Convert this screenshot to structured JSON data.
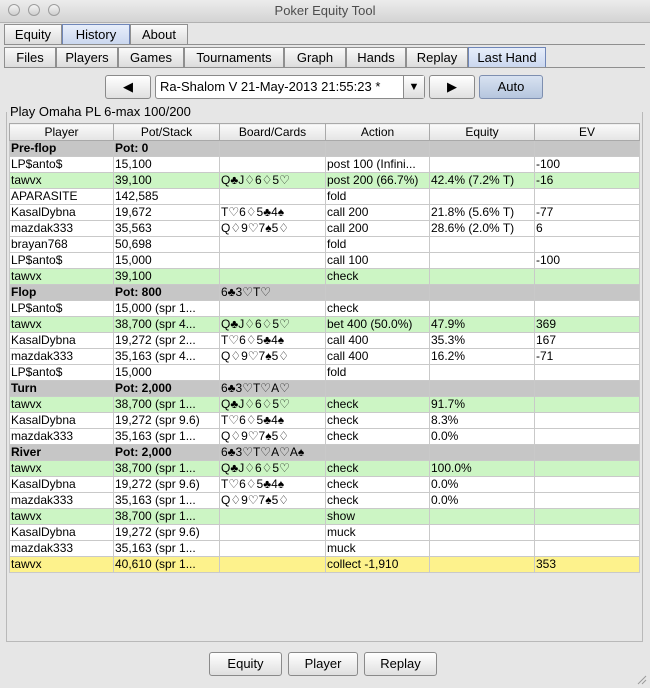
{
  "window": {
    "title": "Poker Equity Tool"
  },
  "main_tabs": [
    "Equity",
    "History",
    "About"
  ],
  "sub_tabs": [
    "Files",
    "Players",
    "Games",
    "Tournaments",
    "Graph",
    "Hands",
    "Replay",
    "Last Hand"
  ],
  "nav": {
    "prev_icon": "left-triangle-icon",
    "hand_select": "Ra-Shalom V 21-May-2013 21:55:23 *",
    "dropdown_icon": "chevron-down-icon",
    "next_icon": "right-triangle-icon",
    "auto_label": "Auto"
  },
  "group_title": "Play Omaha PL 6-max 100/200",
  "columns": [
    "Player",
    "Pot/Stack",
    "Board/Cards",
    "Action",
    "Equity",
    "EV"
  ],
  "rows": [
    {
      "type": "street",
      "cells": [
        "Pre-flop",
        "Pot: 0",
        "",
        "",
        "",
        ""
      ]
    },
    {
      "type": "plain",
      "cells": [
        "LP$anto$",
        "15,100",
        "",
        "post 100 (Infini...",
        "",
        "-100"
      ]
    },
    {
      "type": "hero",
      "cells": [
        "tawvx",
        "39,100",
        "Q♣J♢6♢5♡",
        "post 200 (66.7%)",
        "42.4% (7.2% T)",
        "-16"
      ]
    },
    {
      "type": "plain",
      "cells": [
        "APARASITE",
        "142,585",
        "",
        "fold",
        "",
        ""
      ]
    },
    {
      "type": "plain",
      "cells": [
        "KasalDybna",
        "19,672",
        "T♡6♢5♣4♠",
        "call 200",
        "21.8% (5.6% T)",
        "-77"
      ]
    },
    {
      "type": "plain",
      "cells": [
        "mazdak333",
        "35,563",
        "Q♢9♡7♠5♢",
        "call 200",
        "28.6% (2.0% T)",
        "6"
      ]
    },
    {
      "type": "plain",
      "cells": [
        "brayan768",
        "50,698",
        "",
        "fold",
        "",
        ""
      ]
    },
    {
      "type": "plain",
      "cells": [
        "LP$anto$",
        "15,000",
        "",
        "call 100",
        "",
        "-100"
      ]
    },
    {
      "type": "hero",
      "cells": [
        "tawvx",
        "39,100",
        "",
        "check",
        "",
        ""
      ]
    },
    {
      "type": "street",
      "cells": [
        "Flop",
        "Pot: 800",
        "6♣3♡T♡",
        "",
        "",
        ""
      ]
    },
    {
      "type": "plain",
      "cells": [
        "LP$anto$",
        "15,000 (spr 1...",
        "",
        "check",
        "",
        ""
      ]
    },
    {
      "type": "hero",
      "cells": [
        "tawvx",
        "38,700 (spr 4...",
        "Q♣J♢6♢5♡",
        "bet 400 (50.0%)",
        "47.9%",
        "369"
      ]
    },
    {
      "type": "plain",
      "cells": [
        "KasalDybna",
        "19,272 (spr 2...",
        "T♡6♢5♣4♠",
        "call 400",
        "35.3%",
        "167"
      ]
    },
    {
      "type": "plain",
      "cells": [
        "mazdak333",
        "35,163 (spr 4...",
        "Q♢9♡7♠5♢",
        "call 400",
        "16.2%",
        "-71"
      ]
    },
    {
      "type": "plain",
      "cells": [
        "LP$anto$",
        "15,000",
        "",
        "fold",
        "",
        ""
      ]
    },
    {
      "type": "street",
      "cells": [
        "Turn",
        "Pot: 2,000",
        "6♣3♡T♡A♡",
        "",
        "",
        ""
      ]
    },
    {
      "type": "hero",
      "cells": [
        "tawvx",
        "38,700 (spr 1...",
        "Q♣J♢6♢5♡",
        "check",
        "91.7%",
        ""
      ]
    },
    {
      "type": "plain",
      "cells": [
        "KasalDybna",
        "19,272 (spr 9.6)",
        "T♡6♢5♣4♠",
        "check",
        "8.3%",
        ""
      ]
    },
    {
      "type": "plain",
      "cells": [
        "mazdak333",
        "35,163 (spr 1...",
        "Q♢9♡7♠5♢",
        "check",
        "0.0%",
        ""
      ]
    },
    {
      "type": "street",
      "cells": [
        "River",
        "Pot: 2,000",
        "6♣3♡T♡A♡A♠",
        "",
        "",
        ""
      ]
    },
    {
      "type": "hero",
      "cells": [
        "tawvx",
        "38,700 (spr 1...",
        "Q♣J♢6♢5♡",
        "check",
        "100.0%",
        ""
      ]
    },
    {
      "type": "plain",
      "cells": [
        "KasalDybna",
        "19,272 (spr 9.6)",
        "T♡6♢5♣4♠",
        "check",
        "0.0%",
        ""
      ]
    },
    {
      "type": "plain",
      "cells": [
        "mazdak333",
        "35,163 (spr 1...",
        "Q♢9♡7♠5♢",
        "check",
        "0.0%",
        ""
      ]
    },
    {
      "type": "hero",
      "cells": [
        "tawvx",
        "38,700 (spr 1...",
        "",
        "show",
        "",
        ""
      ]
    },
    {
      "type": "plain",
      "cells": [
        "KasalDybna",
        "19,272 (spr 9.6)",
        "",
        "muck",
        "",
        ""
      ]
    },
    {
      "type": "plain",
      "cells": [
        "mazdak333",
        "35,163 (spr 1...",
        "",
        "muck",
        "",
        ""
      ]
    },
    {
      "type": "win",
      "cells": [
        "tawvx",
        "40,610 (spr 1...",
        "",
        "collect -1,910",
        "",
        "353"
      ]
    }
  ],
  "bottom_buttons": [
    "Equity",
    "Player",
    "Replay"
  ],
  "colors": {
    "hero_row": "#ccf5c4",
    "street_row": "#c6c6c6",
    "winner_row": "#fdf28c",
    "active_tab": "#c9d6ee"
  }
}
